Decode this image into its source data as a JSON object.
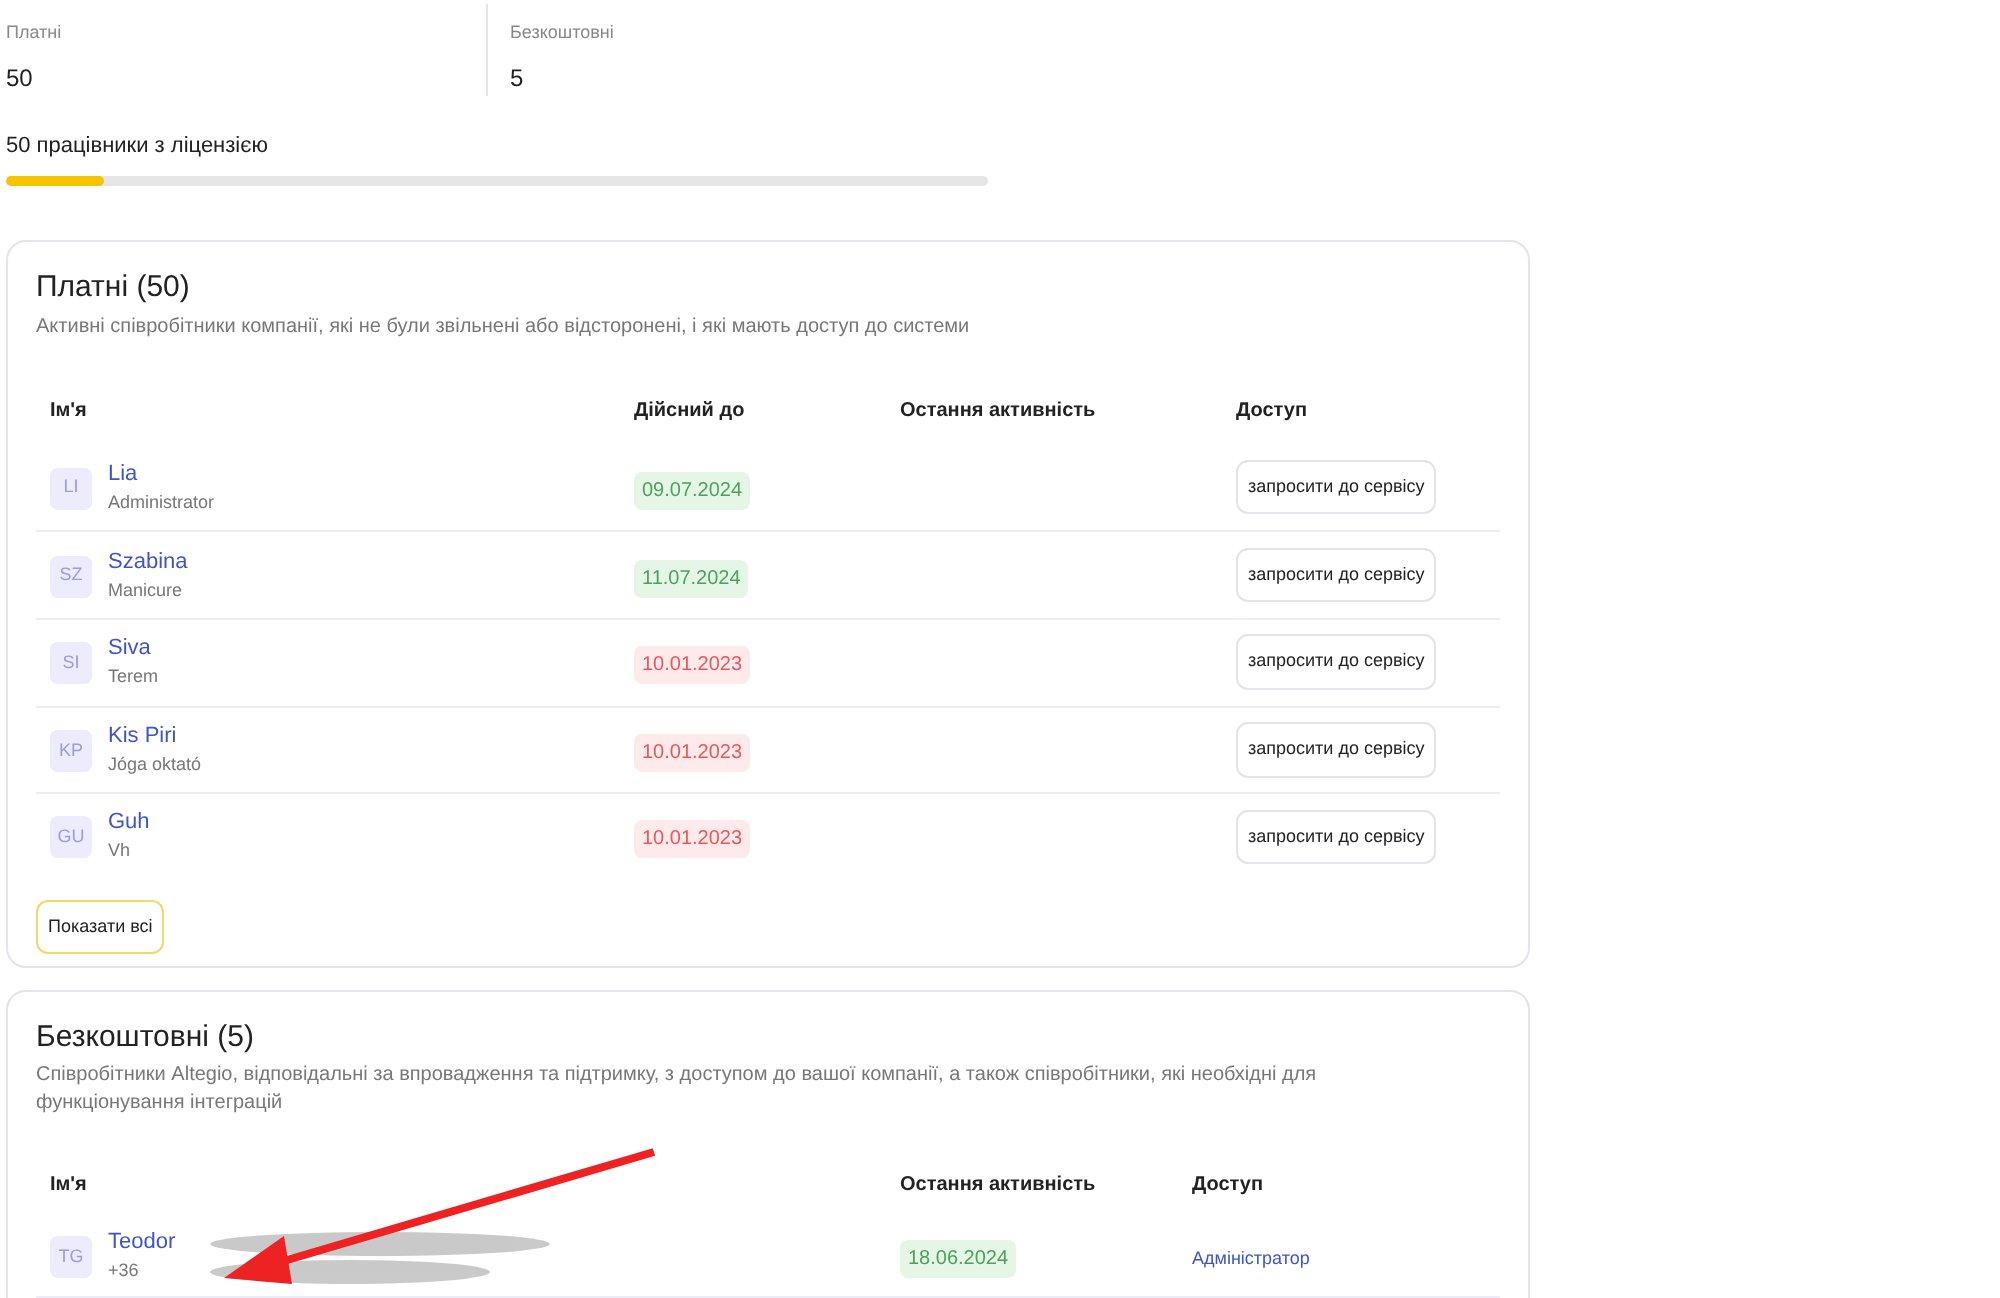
{
  "stats": [
    {
      "label": "Платні",
      "value": "50"
    },
    {
      "label": "Безкоштовні",
      "value": "5"
    }
  ],
  "license": {
    "label": "50 працівники з ліцензією",
    "level": 0.1
  },
  "paid": {
    "title": "Платні (50)",
    "description": "Активні співробітники компанії, які не були звільнені або відсторонені, і які мають доступ до системи",
    "columns": [
      "Ім'я",
      "Дійсний до",
      "Остання активність",
      "Доступ"
    ],
    "rows": [
      {
        "initials": "LI",
        "name": "Lia",
        "role": "Administrator",
        "valid_until": "09.07.2024",
        "expired": false,
        "access": "запросити до сервісу"
      },
      {
        "initials": "SZ",
        "name": "Szabina",
        "role": "Manicure",
        "valid_until": "11.07.2024",
        "expired": false,
        "access": "запросити до сервісу"
      },
      {
        "initials": "SI",
        "name": "Siva",
        "role": "Terem",
        "valid_until": "10.01.2023",
        "expired": true,
        "access": "запросити до сервісу"
      },
      {
        "initials": "KP",
        "name": "Kis Piri",
        "role": "Jóga oktató",
        "valid_until": "10.01.2023",
        "expired": true,
        "access": "запросити до сервісу"
      },
      {
        "initials": "GU",
        "name": "Guh",
        "role": "Vh",
        "valid_until": "10.01.2023",
        "expired": true,
        "access": "запросити до сервісу"
      }
    ],
    "show_all": "Показати всі"
  },
  "free": {
    "title": "Безкоштовні (5)",
    "description": "Співробітники Altegio, відповідальні за впровадження та підтримку, з доступом до вашої компанії, а також співробітники, які необхідні для функціонування інтеграцій",
    "columns": [
      "Ім'я",
      "Остання активність",
      "Доступ"
    ],
    "rows": [
      {
        "initials": "TG",
        "name": "Teodor",
        "role": "+36",
        "last_activity": "18.06.2024",
        "expired": false,
        "access": "Адміністратор"
      }
    ]
  }
}
